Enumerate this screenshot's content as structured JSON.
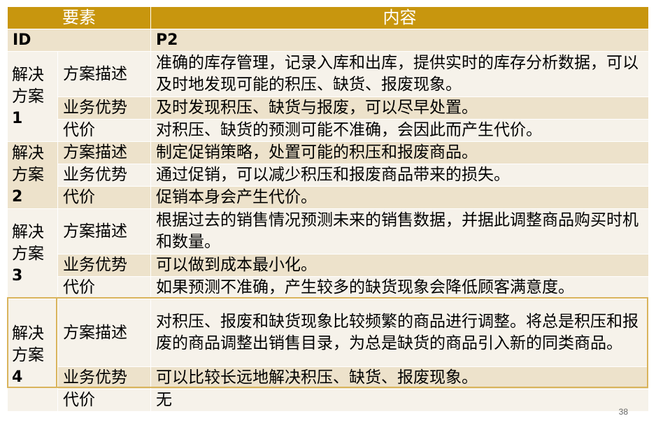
{
  "header": {
    "element": "要素",
    "content": "内容"
  },
  "id_row": {
    "label": "ID",
    "value": "P2"
  },
  "solutions": [
    {
      "line1": "解决",
      "line2": "方案",
      "num": "1",
      "rows": [
        {
          "label": "方案描述",
          "text": "准确的库存管理，记录入库和出库，提供实时的库存分析数据，可以及时地发现可能的积压、缺货、报废现象。"
        },
        {
          "label": "业务优势",
          "text": "及时发现积压、缺货与报废，可以尽早处置。"
        },
        {
          "label": "代价",
          "text": "对积压、缺货的预测可能不准确，会因此而产生代价。"
        }
      ]
    },
    {
      "line1": "解决",
      "line2": "方案",
      "num": "2",
      "rows": [
        {
          "label": "方案描述",
          "text": "制定促销策略，处置可能的积压和报废商品。"
        },
        {
          "label": "业务优势",
          "text": "通过促销，可以减少积压和报废商品带来的损失。"
        },
        {
          "label": "代价",
          "text": "促销本身会产生代价。"
        }
      ]
    },
    {
      "line1": "解决",
      "line2": "方案",
      "num": "3",
      "rows": [
        {
          "label": "方案描述",
          "text": "根据过去的销售情况预测未来的销售数据，并据此调整商品购买时机和数量。"
        },
        {
          "label": "业务优势",
          "text": "可以做到成本最小化。"
        },
        {
          "label": "代价",
          "text": "如果预测不准确，产生较多的缺货现象会降低顾客满意度。"
        }
      ]
    },
    {
      "line1": "解决",
      "line2": "方案",
      "num": "4",
      "rows": [
        {
          "label": "方案描述",
          "text": "对积压、报废和缺货现象比较频繁的商品进行调整。将总是积压和报废的商品调整出销售目录，为总是缺货的商品引入新的同类商品。"
        },
        {
          "label": "业务优势",
          "text": "可以比较长远地解决积压、缺货、报废现象。"
        },
        {
          "label": "代价",
          "text": "无"
        }
      ]
    }
  ],
  "slide_number": "38",
  "colors": {
    "header": "#c8960e",
    "row_light": "#f6f2ea",
    "row_dark": "#ede2cb"
  }
}
